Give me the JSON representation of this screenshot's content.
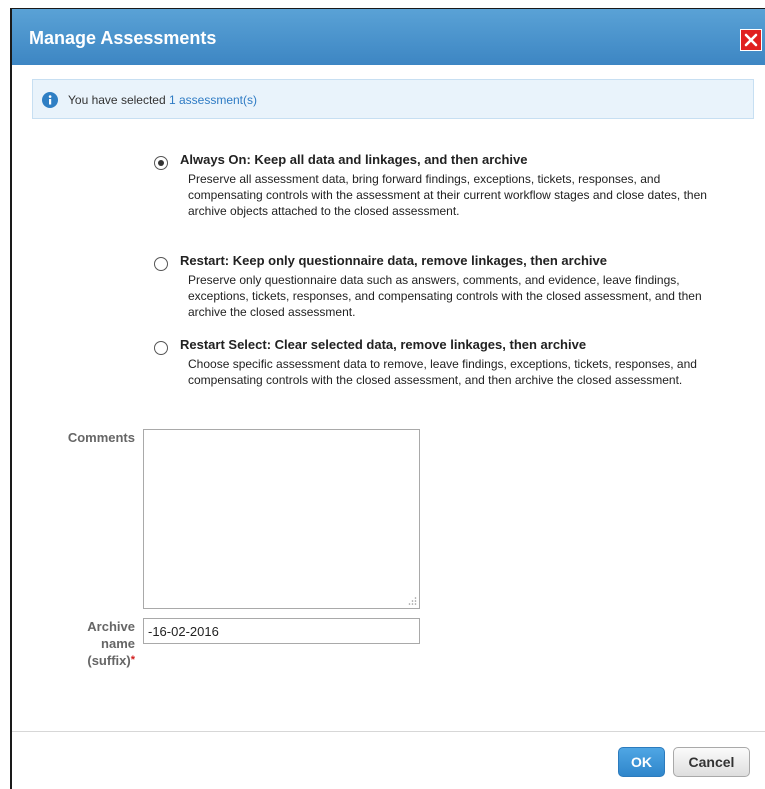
{
  "dialog": {
    "title": "Manage Assessments",
    "close_icon": "close-icon",
    "colors": {
      "titlebar": "#3d86c3",
      "close": "#e02020",
      "accent": "#2e7bc4"
    }
  },
  "info": {
    "icon": "info-icon",
    "text": "You have selected",
    "link": "1 assessment(s)"
  },
  "options": [
    {
      "title": "Always On: Keep all data and linkages, and then archive",
      "description": "Preserve all assessment data, bring forward findings, exceptions, tickets, responses, and compensating controls with the assessment at their current workflow stages and close dates, then archive objects attached to the closed assessment.",
      "selected": true
    },
    {
      "title": "Restart: Keep only questionnaire data, remove linkages, then archive",
      "description": "Preserve only questionnaire data such as answers, comments, and evidence, leave findings, exceptions, tickets, responses, and compensating controls with the closed assessment, and then archive the closed assessment.",
      "selected": false
    },
    {
      "title": "Restart Select: Clear selected data, remove linkages, then archive",
      "description": "Choose specific assessment data to remove, leave findings, exceptions, tickets, responses, and compensating controls with the closed assessment, and then archive the closed assessment.",
      "selected": false
    }
  ],
  "form": {
    "comments_label": "Comments",
    "comments_value": "",
    "archive_label_line1": "Archive",
    "archive_label_line2": "name",
    "archive_label_line3": "(suffix)",
    "required_mark": "*",
    "archive_value": "-16-02-2016"
  },
  "buttons": {
    "ok": "OK",
    "cancel": "Cancel"
  }
}
